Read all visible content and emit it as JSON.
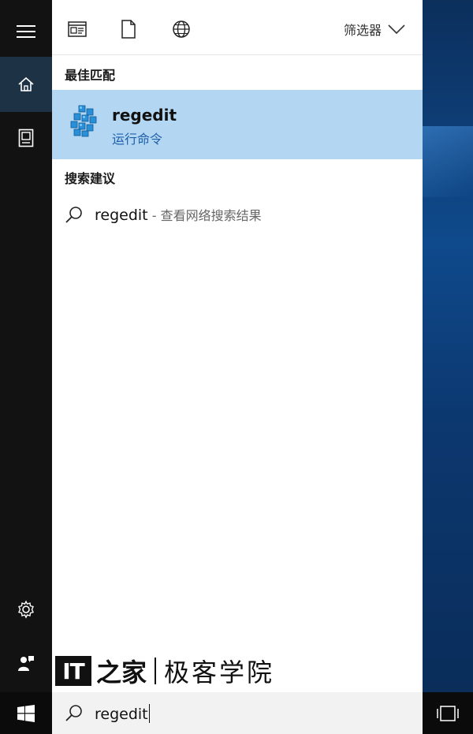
{
  "toolbar": {
    "icons": [
      "apps-icon",
      "document-icon",
      "web-icon"
    ],
    "filter_label": "筛选器"
  },
  "results": {
    "best_match_header": "最佳匹配",
    "best_match": {
      "icon": "regedit-icon",
      "title": "regedit",
      "subtitle": "运行命令"
    },
    "suggestions_header": "搜索建议",
    "suggestions": [
      {
        "icon": "search-icon",
        "query": "regedit",
        "hint": " - 查看网络搜索结果"
      }
    ]
  },
  "rail": {
    "items": [
      "hamburger-menu-icon",
      "home-icon",
      "notebook-icon",
      "settings-icon",
      "feedback-icon"
    ]
  },
  "watermark": {
    "badge": "IT",
    "brand_glyphs": "之家",
    "name": "极客学院"
  },
  "searchbox": {
    "value": "regedit"
  },
  "colors": {
    "selection": "#b3d7f2",
    "accent_text": "#1f5fa8",
    "rail_bg": "#121212",
    "rail_active": "#1d3345"
  }
}
